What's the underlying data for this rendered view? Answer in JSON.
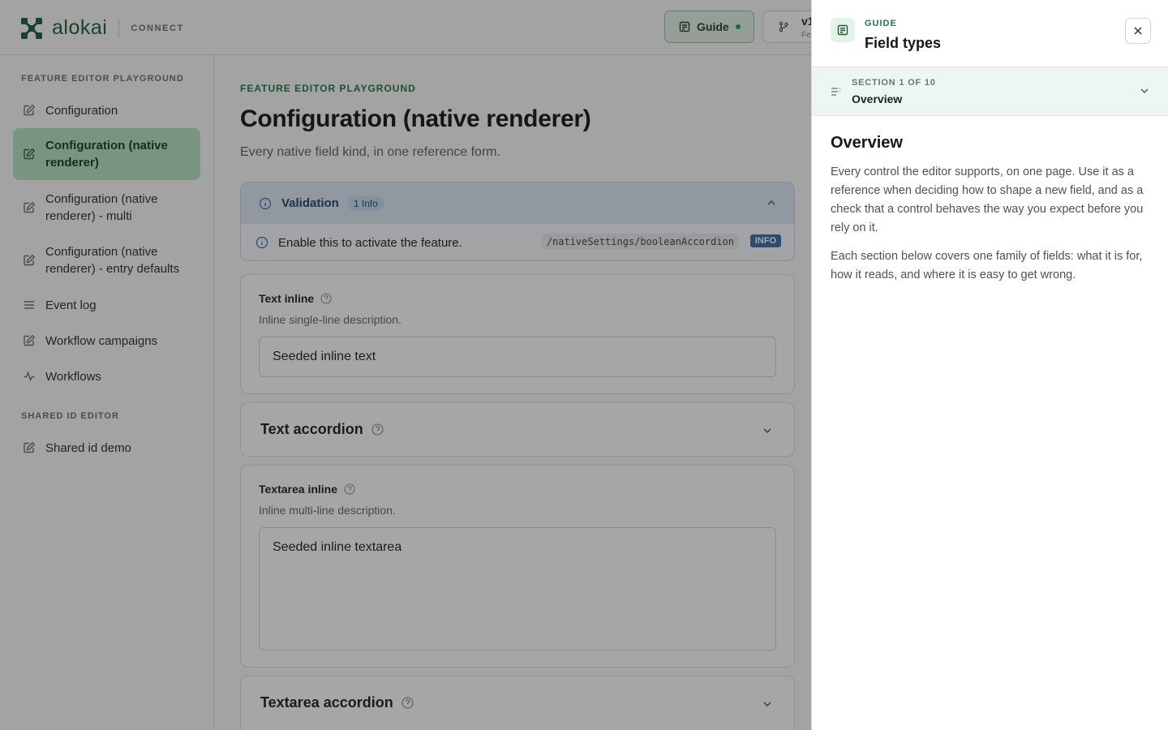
{
  "header": {
    "brand": "alokai",
    "product": "CONNECT",
    "guide_label": "Guide",
    "version_label": "v1",
    "version_sub": "Fe"
  },
  "sidebar": {
    "sections": [
      {
        "heading": "FEATURE EDITOR PLAYGROUND",
        "items": [
          {
            "label": "Configuration",
            "icon": "edit-icon",
            "active": false
          },
          {
            "label": "Configuration (native renderer)",
            "icon": "edit-icon",
            "active": true
          },
          {
            "label": "Configuration (native renderer) - multi",
            "icon": "edit-icon",
            "active": false
          },
          {
            "label": "Configuration (native renderer) - entry defaults",
            "icon": "edit-icon",
            "active": false
          },
          {
            "label": "Event log",
            "icon": "list-icon",
            "active": false
          },
          {
            "label": "Workflow campaigns",
            "icon": "edit-icon",
            "active": false
          },
          {
            "label": "Workflows",
            "icon": "activity-icon",
            "active": false
          }
        ]
      },
      {
        "heading": "SHARED ID EDITOR",
        "items": [
          {
            "label": "Shared id demo",
            "icon": "edit-icon",
            "active": false
          }
        ]
      }
    ]
  },
  "main": {
    "eyebrow": "FEATURE EDITOR PLAYGROUND",
    "title": "Configuration (native renderer)",
    "subtitle": "Every native field kind, in one reference form.",
    "validation": {
      "title": "Validation",
      "count_badge": "1 Info",
      "message": "Enable this to activate the feature.",
      "path": "/nativeSettings/booleanAccordion",
      "level": "INFO"
    },
    "fields": {
      "text_inline": {
        "label": "Text inline",
        "description": "Inline single-line description.",
        "value": "Seeded inline text"
      },
      "text_accordion": {
        "label": "Text accordion"
      },
      "textarea_inline": {
        "label": "Textarea inline",
        "description": "Inline multi-line description.",
        "value": "Seeded inline textarea"
      },
      "textarea_accordion": {
        "label": "Textarea accordion"
      }
    }
  },
  "drawer": {
    "eyebrow": "GUIDE",
    "title": "Field types",
    "section_counter": "SECTION 1 OF 10",
    "section_name": "Overview",
    "heading": "Overview",
    "paragraphs": [
      "Every control the editor supports, on one page. Use it as a reference when deciding how to shape a new field, and as a check that a control behaves the way you expect before you rely on it.",
      "Each section below covers one family of fields: what it is for, how it reads, and where it is easy to get wrong."
    ]
  },
  "colors": {
    "brand_green": "#1b5e3a",
    "accent_green": "#1a7a43",
    "active_nav_bg": "#b8e3c5",
    "info_blue": "#3d6fae"
  }
}
